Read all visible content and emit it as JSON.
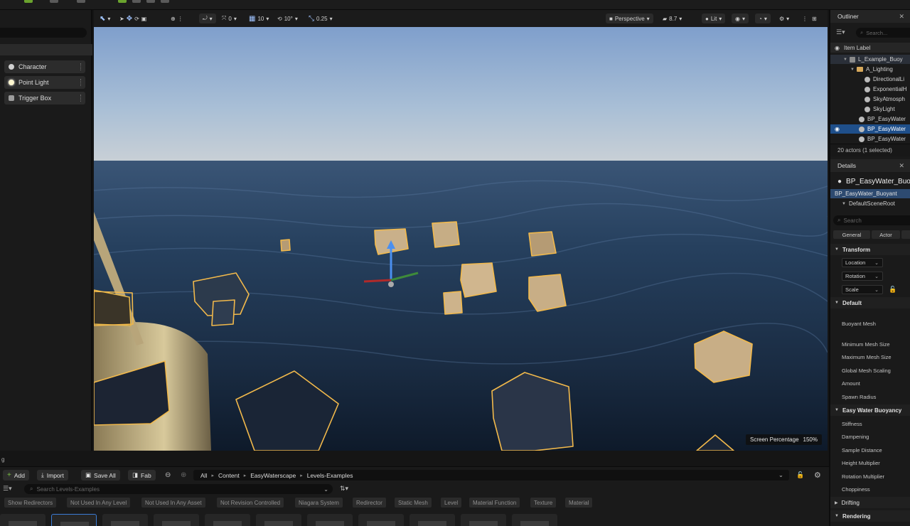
{
  "place_actors": {
    "items": [
      {
        "label": "Character",
        "icon": "character-icon"
      },
      {
        "label": "Point Light",
        "icon": "point-light-icon"
      },
      {
        "label": "Trigger Box",
        "icon": "trigger-box-icon"
      }
    ]
  },
  "viewport": {
    "toolbar": {
      "rotate_snap": "0",
      "grid_snap": "10",
      "angle_snap": "10°",
      "scale_snap": "0.25",
      "view_mode": "Perspective",
      "camera_speed": "8.7",
      "lighting_mode": "Lit"
    },
    "screen_percentage_label": "Screen Percentage",
    "screen_percentage_value": "150%"
  },
  "outliner": {
    "title": "Outliner",
    "search_placeholder": "Search...",
    "column_header": "Item Label",
    "rows": [
      {
        "label": "L_Example_Buoy",
        "indent": 1,
        "type": "map"
      },
      {
        "label": "A_Lighting",
        "indent": 2,
        "type": "folder"
      },
      {
        "label": "DirectionalLi",
        "indent": 3,
        "type": "actor"
      },
      {
        "label": "ExponentialH",
        "indent": 3,
        "type": "actor"
      },
      {
        "label": "SkyAtmosph",
        "indent": 3,
        "type": "actor"
      },
      {
        "label": "SkyLight",
        "indent": 3,
        "type": "actor"
      },
      {
        "label": "BP_EasyWater",
        "indent": 2,
        "type": "actor"
      },
      {
        "label": "BP_EasyWater",
        "indent": 2,
        "type": "actor",
        "selected": true
      },
      {
        "label": "BP_EasyWater",
        "indent": 2,
        "type": "actor"
      }
    ],
    "actor_count": "20 actors (1 selected)"
  },
  "details": {
    "title": "Details",
    "object_name": "BP_EasyWater_Buo",
    "component_instance": "BP_EasyWater_Buoyant",
    "component_root": "DefaultSceneRoot",
    "search_placeholder": "Search",
    "tabs": [
      "General",
      "Actor"
    ],
    "sections": {
      "transform": {
        "title": "Transform",
        "fields": [
          "Location",
          "Rotation",
          "Scale"
        ]
      },
      "default": {
        "title": "Default",
        "props": [
          "Buoyant Mesh",
          "Minimum Mesh Size",
          "Maximum Mesh Size",
          "Global Mesh Scaling",
          "Amount",
          "Spawn Radius"
        ]
      },
      "buoyancy": {
        "title": "Easy Water Buoyancy",
        "props": [
          "Stiffness",
          "Dampening",
          "Sample Distance",
          "Height Multiplier",
          "Rotation Multiplier",
          "Choppiness"
        ]
      },
      "drifting": {
        "title": "Drifting"
      },
      "rendering": {
        "title": "Rendering"
      }
    }
  },
  "content_browser": {
    "bottom_label": "g",
    "add_label": "Add",
    "import_label": "Import",
    "save_all_label": "Save All",
    "fab_label": "Fab",
    "breadcrumbs": [
      "All",
      "Content",
      "EasyWaterscape",
      "Levels-Examples"
    ],
    "search_placeholder": "Search Levels-Examples",
    "filters": [
      "Show Redirectors",
      "Not Used In Any Level",
      "Not Used In Any Asset",
      "Not Revision Controlled",
      "Niagara System",
      "Redirector",
      "Static Mesh",
      "Level",
      "Material Function",
      "Texture",
      "Material"
    ]
  }
}
